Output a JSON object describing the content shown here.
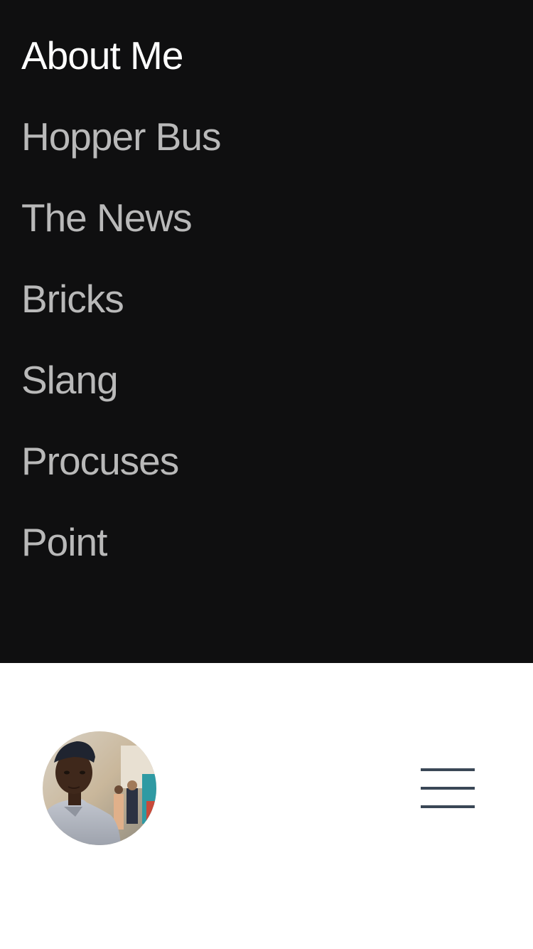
{
  "menu": {
    "items": [
      {
        "label": "About Me",
        "active": true
      },
      {
        "label": "Hopper Bus",
        "active": false
      },
      {
        "label": "The News",
        "active": false
      },
      {
        "label": "Bricks",
        "active": false
      },
      {
        "label": "Slang",
        "active": false
      },
      {
        "label": "Procuses",
        "active": false
      },
      {
        "label": "Point",
        "active": false
      }
    ]
  },
  "colors": {
    "menu_background": "#0f0f10",
    "active_item": "#ffffff",
    "inactive_item": "#b9b9b9",
    "hamburger": "#3a4756",
    "bottom_background": "#ffffff"
  },
  "icons": {
    "avatar": "profile-photo",
    "menu_toggle": "hamburger-icon"
  }
}
